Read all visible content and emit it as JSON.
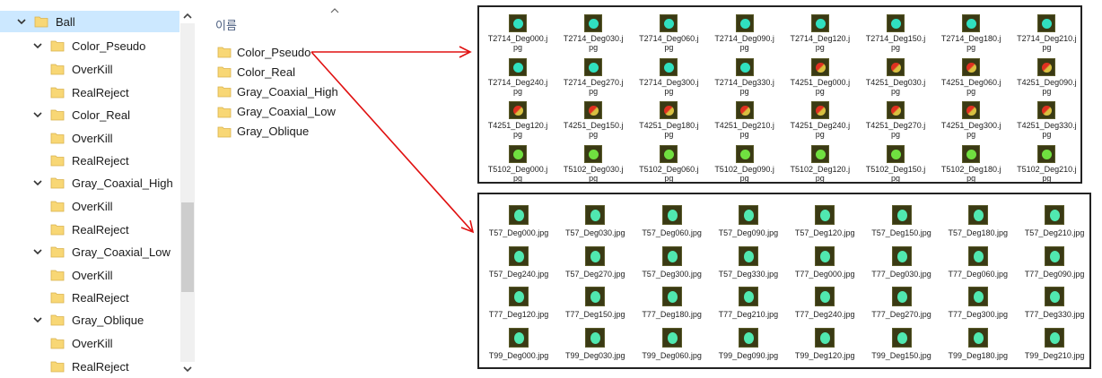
{
  "tree": {
    "items": [
      {
        "label": "Ball",
        "level": 0,
        "expanded": true,
        "selected": true
      },
      {
        "label": "Color_Pseudo",
        "level": 1,
        "expanded": true
      },
      {
        "label": "OverKill",
        "level": 2
      },
      {
        "label": "RealReject",
        "level": 2
      },
      {
        "label": "Color_Real",
        "level": 1,
        "expanded": true
      },
      {
        "label": "OverKill",
        "level": 2
      },
      {
        "label": "RealReject",
        "level": 2
      },
      {
        "label": "Gray_Coaxial_High",
        "level": 1,
        "expanded": true
      },
      {
        "label": "OverKill",
        "level": 2
      },
      {
        "label": "RealReject",
        "level": 2
      },
      {
        "label": "Gray_Coaxial_Low",
        "level": 1,
        "expanded": true
      },
      {
        "label": "OverKill",
        "level": 2
      },
      {
        "label": "RealReject",
        "level": 2
      },
      {
        "label": "Gray_Oblique",
        "level": 1,
        "expanded": true
      },
      {
        "label": "OverKill",
        "level": 2
      },
      {
        "label": "RealReject",
        "level": 2
      }
    ]
  },
  "files": {
    "column_header": "이름",
    "items": [
      "Color_Pseudo",
      "Color_Real",
      "Gray_Coaxial_High",
      "Gray_Coaxial_Low",
      "Gray_Oblique"
    ]
  },
  "panel1": {
    "thumbs": [
      [
        "T2714_Deg000.j",
        "pg"
      ],
      [
        "T2714_Deg030.j",
        "pg"
      ],
      [
        "T2714_Deg060.j",
        "pg"
      ],
      [
        "T2714_Deg090.j",
        "pg"
      ],
      [
        "T2714_Deg120.j",
        "pg"
      ],
      [
        "T2714_Deg150.j",
        "pg"
      ],
      [
        "T2714_Deg180.j",
        "pg"
      ],
      [
        "T2714_Deg210.j",
        "pg"
      ],
      [
        "T2714_Deg240.j",
        "pg"
      ],
      [
        "T2714_Deg270.j",
        "pg"
      ],
      [
        "T2714_Deg300.j",
        "pg"
      ],
      [
        "T2714_Deg330.j",
        "pg"
      ],
      [
        "T4251_Deg000.j",
        "pg"
      ],
      [
        "T4251_Deg030.j",
        "pg"
      ],
      [
        "T4251_Deg060.j",
        "pg"
      ],
      [
        "T4251_Deg090.j",
        "pg"
      ],
      [
        "T4251_Deg120.j",
        "pg"
      ],
      [
        "T4251_Deg150.j",
        "pg"
      ],
      [
        "T4251_Deg180.j",
        "pg"
      ],
      [
        "T4251_Deg210.j",
        "pg"
      ],
      [
        "T4251_Deg240.j",
        "pg"
      ],
      [
        "T4251_Deg270.j",
        "pg"
      ],
      [
        "T4251_Deg300.j",
        "pg"
      ],
      [
        "T4251_Deg330.j",
        "pg"
      ],
      [
        "T5102_Deg000.j",
        "pg"
      ],
      [
        "T5102_Deg030.j",
        "pg"
      ],
      [
        "T5102_Deg060.j",
        "pg"
      ],
      [
        "T5102_Deg090.j",
        "pg"
      ],
      [
        "T5102_Deg120.j",
        "pg"
      ],
      [
        "T5102_Deg150.j",
        "pg"
      ],
      [
        "T5102_Deg180.j",
        "pg"
      ],
      [
        "T5102_Deg210.j",
        "pg"
      ]
    ]
  },
  "panel2": {
    "thumbs": [
      "T57_Deg000.jpg",
      "T57_Deg030.jpg",
      "T57_Deg060.jpg",
      "T57_Deg090.jpg",
      "T57_Deg120.jpg",
      "T57_Deg150.jpg",
      "T57_Deg180.jpg",
      "T57_Deg210.jpg",
      "T57_Deg240.jpg",
      "T57_Deg270.jpg",
      "T57_Deg300.jpg",
      "T57_Deg330.jpg",
      "T77_Deg000.jpg",
      "T77_Deg030.jpg",
      "T77_Deg060.jpg",
      "T77_Deg090.jpg",
      "T77_Deg120.jpg",
      "T77_Deg150.jpg",
      "T77_Deg180.jpg",
      "T77_Deg210.jpg",
      "T77_Deg240.jpg",
      "T77_Deg270.jpg",
      "T77_Deg300.jpg",
      "T77_Deg330.jpg",
      "T99_Deg000.jpg",
      "T99_Deg030.jpg",
      "T99_Deg060.jpg",
      "T99_Deg090.jpg",
      "T99_Deg120.jpg",
      "T99_Deg150.jpg",
      "T99_Deg180.jpg",
      "T99_Deg210.jpg"
    ]
  },
  "colors": {
    "selection": "#cce8ff",
    "folder": "#f8d775",
    "arrow": "#e01010",
    "ball": "#30e0c0",
    "defect": "#e03020"
  }
}
